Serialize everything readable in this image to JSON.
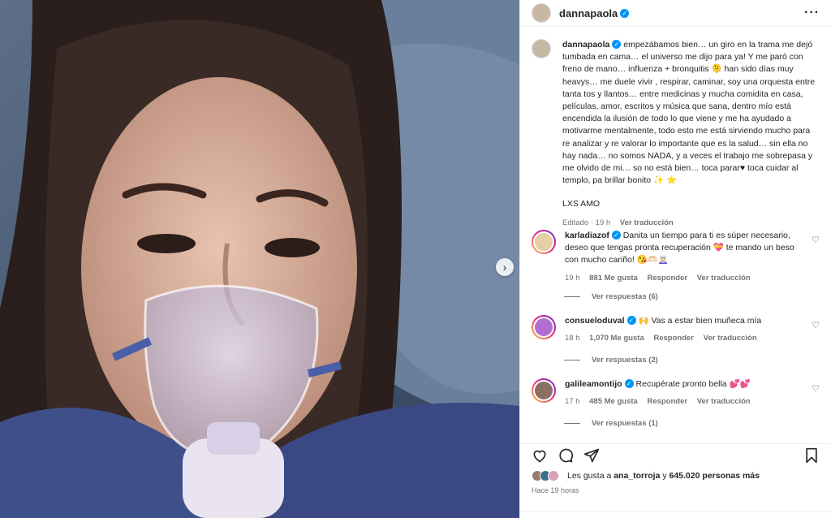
{
  "post": {
    "username": "dannapaola",
    "caption": "empezábamos bien… un giro en la trama me dejó tumbada en cama… el universo me dijo para ya! Y me paró con freno de mano… influenza + bronquitis 🫠 han sido días muy heavys… me duele vivir , respirar, caminar, soy una orquesta entre tanta tos y llantos… entre medicinas y mucha comidita en casa, películas, amor, escritos y música que sana, dentro mío está encendida la ilusión de todo lo que viene y me ha ayudado a motivarme mentalmente, todo esto me está sirviendo mucho para re analizar y re valorar lo importante que es la salud… sin ella no hay nada… no somos NADA, y a veces el trabajo me sobrepasa y me olvido de mi… so no está bien… toca parar♥︎ toca cuidar al templo, pa brillar bonito ✨ ⭐️",
    "signoff": "LXS AMO",
    "edited": "Editado · 19 h",
    "translate": "Ver traducción"
  },
  "comments": [
    {
      "username": "karladiazof",
      "text": "Danita un tiempo para ti es súper necesario, deseo que tengas pronta recuperación 💝 te mando un beso con mucho cariño! 😘🫶🏻🧝🏻‍♀️",
      "time": "19 h",
      "likes": "881 Me gusta",
      "reply": "Responder",
      "translate": "Ver traducción",
      "replies": "Ver respuestas (6)"
    },
    {
      "username": "consueloduval",
      "text": "🙌 Vas a estar bien muñeca mía",
      "time": "18 h",
      "likes": "1,070 Me gusta",
      "reply": "Responder",
      "translate": "Ver traducción",
      "replies": "Ver respuestas (2)"
    },
    {
      "username": "galileamontijo",
      "text": "Recupérate pronto bella 💕💕",
      "time": "17 h",
      "likes": "485 Me gusta",
      "reply": "Responder",
      "translate": "Ver traducción",
      "replies": "Ver respuestas (1)"
    }
  ],
  "likes": {
    "prefix": "Les gusta a",
    "user": "ana_torroja",
    "middle": "y",
    "count": "645.020 personas más"
  },
  "posted": "Hace 19 horas",
  "icons": {
    "more": "more-options-icon",
    "like": "heart-icon",
    "comment": "comment-icon",
    "share": "share-icon",
    "save": "bookmark-icon",
    "next": "chevron-right-icon"
  },
  "colors": {
    "verified": "#0095f6",
    "secondary_text": "#737373"
  }
}
